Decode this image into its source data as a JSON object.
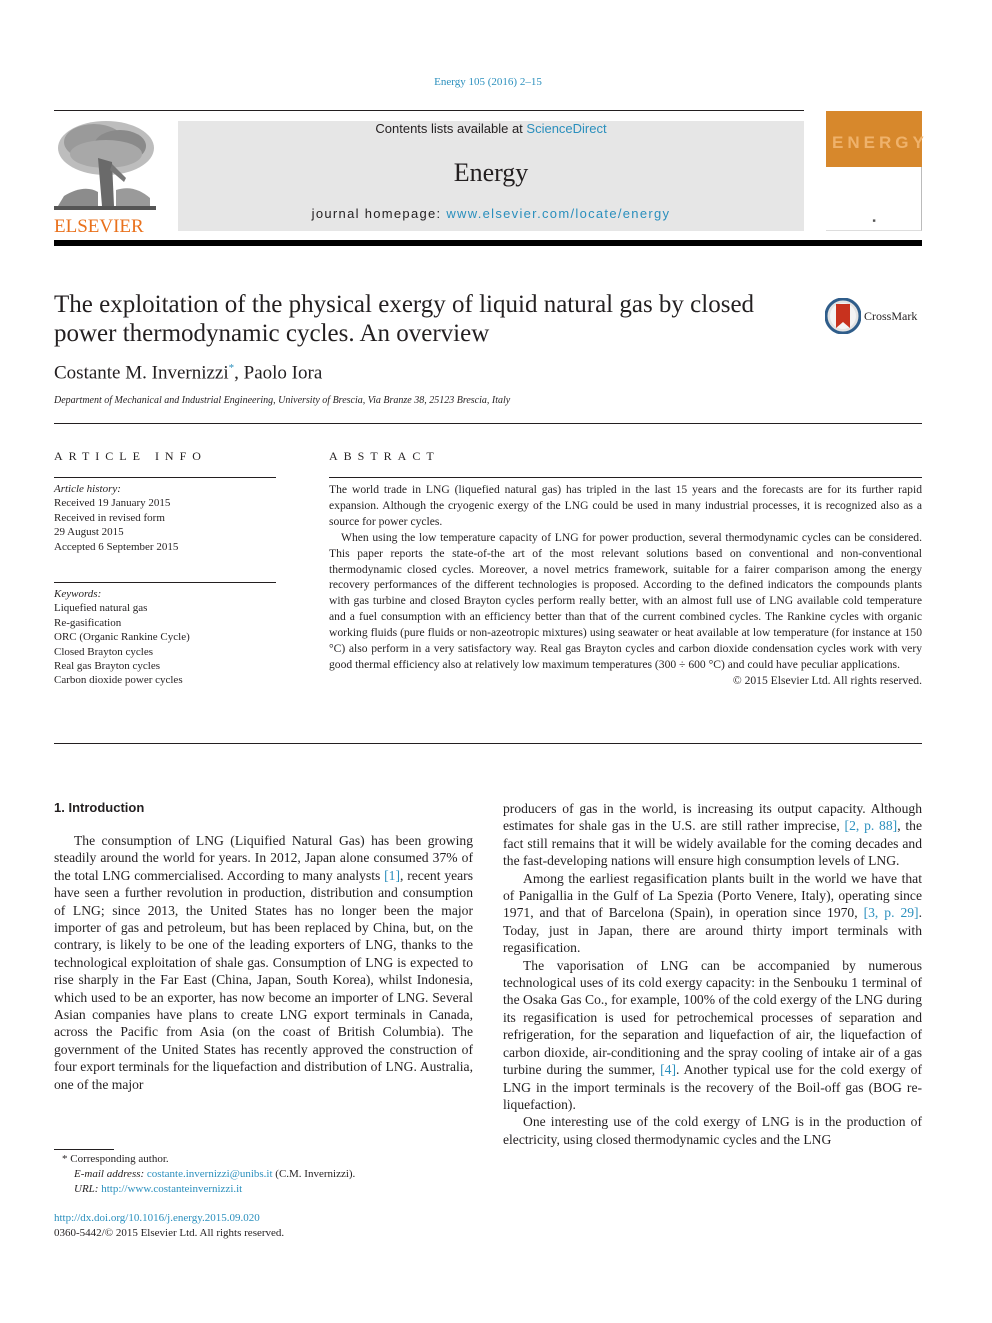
{
  "header": {
    "journal_ref": "Energy 105 (2016) 2–15",
    "contents_prefix": "Contents lists available at ",
    "contents_link": "ScienceDirect",
    "journal_name": "Energy",
    "homepage_prefix": "journal homepage: ",
    "homepage_link": "www.elsevier.com/locate/energy",
    "publisher_logo_text": "ELSEVIER",
    "cover_title": "ENERGY",
    "brand_orange": "#e9711c",
    "link_color": "#2a8fbd"
  },
  "article": {
    "title": "The exploitation of the physical exergy of liquid natural gas by closed power thermodynamic cycles. An overview",
    "crossmark_label": "CrossMark",
    "author1": "Costante M. Invernizzi",
    "author1_mark": "*",
    "author_sep": ", ",
    "author2": "Paolo Iora",
    "affiliation": "Department of Mechanical and Industrial Engineering, University of Brescia, Via Branze 38, 25123 Brescia, Italy"
  },
  "article_info": {
    "heading": "ARTICLE INFO",
    "history_label": "Article history:",
    "history": [
      "Received 19 January 2015",
      "Received in revised form",
      "29 August 2015",
      "Accepted 6 September 2015"
    ],
    "keywords_label": "Keywords:",
    "keywords": [
      "Liquefied natural gas",
      "Re-gasification",
      "ORC (Organic Rankine Cycle)",
      "Closed Brayton cycles",
      "Real gas Brayton cycles",
      "Carbon dioxide power cycles"
    ]
  },
  "abstract": {
    "heading": "ABSTRACT",
    "paragraphs": [
      "The world trade in LNG (liquefied natural gas) has tripled in the last 15 years and the forecasts are for its further rapid expansion. Although the cryogenic exergy of the LNG could be used in many industrial processes, it is recognized also as a source for power cycles.",
      "When using the low temperature capacity of LNG for power production, several thermodynamic cycles can be considered. This paper reports the state-of-the art of the most relevant solutions based on conventional and non-conventional thermodynamic closed cycles. Moreover, a novel metrics framework, suitable for a fairer comparison among the energy recovery performances of the different technologies is proposed. According to the defined indicators the compounds plants with gas turbine and closed Brayton cycles perform really better, with an almost full use of LNG available cold temperature and a fuel consumption with an efficiency better than that of the current combined cycles. The Rankine cycles with organic working fluids (pure fluids or non-azeotropic mixtures) using seawater or heat available at low temperature (for instance at 150 °C) also perform in a very satisfactory way. Real gas Brayton cycles and carbon dioxide condensation cycles work with very good thermal efficiency also at relatively low maximum temperatures (300 ÷ 600 °C) and could have peculiar applications."
    ],
    "copyright": "© 2015 Elsevier Ltd. All rights reserved."
  },
  "body": {
    "section_heading": "1.  Introduction",
    "left": {
      "p1_a": "The consumption of LNG (Liquified Natural Gas) has been growing steadily around the world for years. In 2012, Japan alone consumed 37% of the total LNG commercialised. According to many analysts ",
      "p1_ref1": "[1]",
      "p1_b": ", recent years have seen a further revolution in production, distribution and consumption of LNG; since 2013, the United States has no longer been the major importer of gas and petroleum, but has been replaced by China, but, on the contrary, is likely to be one of the leading exporters of LNG, thanks to the technological exploitation of shale gas. Consumption of LNG is expected to rise sharply in the Far East (China, Japan, South Korea), whilst Indonesia, which used to be an exporter, has now become an importer of LNG. Several Asian companies have plans to create LNG export terminals in Canada, across the Pacific from Asia (on the coast of British Columbia). The government of the United States has recently approved the construction of four export terminals for the liquefaction and distribution of LNG. Australia, one of the major"
    },
    "right": {
      "p1_a": "producers of gas in the world, is increasing its output capacity. Although estimates for shale gas in the U.S. are still rather imprecise, ",
      "p1_ref": "[2, p. 88]",
      "p1_b": ", the fact still remains that it will be widely available for the coming decades and the fast-developing nations will ensure high consumption levels of LNG.",
      "p2_a": "Among the earliest regasification plants built in the world we have that of Panigallia in the Gulf of La Spezia (Porto Venere, Italy), operating since 1971, and that of Barcelona (Spain), in operation since 1970, ",
      "p2_ref": "[3, p. 29]",
      "p2_b": ". Today, just in Japan, there are around thirty import terminals with regasification.",
      "p3_a": "The vaporisation of LNG can be accompanied by numerous technological uses of its cold exergy capacity: in the Senbouku 1 terminal of the Osaka Gas Co., for example, 100% of the cold exergy of the LNG during its regasification is used for petrochemical processes of separation and refrigeration, for the separation and liquefaction of air, the liquefaction of carbon dioxide, air-conditioning and the spray cooling of intake air of a gas turbine during the summer, ",
      "p3_ref": "[4]",
      "p3_b": ". Another typical use for the cold exergy of LNG in the import terminals is the recovery of the Boil-off gas (BOG re-liquefaction).",
      "p4": "One interesting use of the cold exergy of LNG is in the production of electricity, using closed thermodynamic cycles and the LNG"
    }
  },
  "footnotes": {
    "corresponding": "* Corresponding author.",
    "email_label": "E-mail address: ",
    "email": "costante.invernizzi@unibs.it",
    "email_suffix": " (C.M. Invernizzi).",
    "url_label": "URL: ",
    "url": "http://www.costanteinvernizzi.it"
  },
  "footer": {
    "doi": "http://dx.doi.org/10.1016/j.energy.2015.09.020",
    "issn_copyright": "0360-5442/© 2015 Elsevier Ltd. All rights reserved."
  }
}
